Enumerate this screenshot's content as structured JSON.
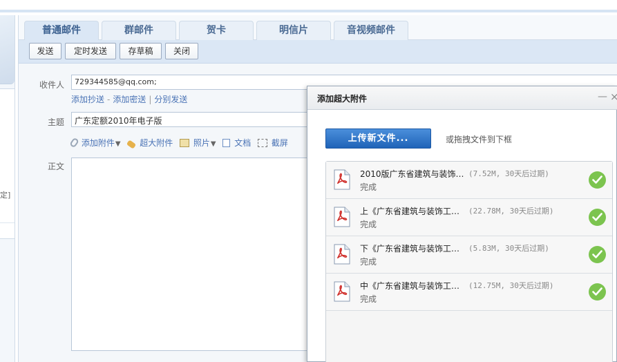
{
  "tabs": [
    {
      "label": "普通邮件",
      "active": true
    },
    {
      "label": "群邮件"
    },
    {
      "label": "贺卡"
    },
    {
      "label": "明信片"
    },
    {
      "label": "音视频邮件"
    }
  ],
  "toolbar": {
    "send": "发送",
    "timed_send": "定时发送",
    "save_draft": "存草稿",
    "close": "关闭"
  },
  "compose": {
    "to_label": "收件人",
    "to_value": "729344585@qq.com;",
    "add_cc": "添加抄送",
    "dash": "-",
    "add_bcc": "添加密送",
    "pipe": "|",
    "separate_send": "分别发送",
    "subject_label": "主题",
    "subject_value": "广东定额2010年电子版",
    "body_label": "正文",
    "attach": "添加附件",
    "big_attach": "超大附件",
    "photo": "照片",
    "doc": "文档",
    "screenshot": "截屏"
  },
  "sidebar": {
    "fragment": "定]"
  },
  "dialog": {
    "title": "添加超大附件",
    "minimize": "—",
    "close": "×",
    "upload_button": "上传新文件...",
    "drag_hint": "或拖拽文件到下框",
    "files": [
      {
        "name": "2010版广东省建筑与装饰…",
        "meta": "(7.52M, 30天后过期)",
        "status": "完成"
      },
      {
        "name": "上《广东省建筑与装饰工…",
        "meta": "(22.78M, 30天后过期)",
        "status": "完成"
      },
      {
        "name": "下《广东省建筑与装饰工…",
        "meta": "(5.83M, 30天后过期)",
        "status": "完成"
      },
      {
        "name": "中《广东省建筑与装饰工…",
        "meta": "(12.75M, 30天后过期)",
        "status": "完成"
      }
    ]
  },
  "colors": {
    "accent_blue": "#1f63b8",
    "success_green": "#7cc44f",
    "link_blue": "#4a73b5"
  }
}
